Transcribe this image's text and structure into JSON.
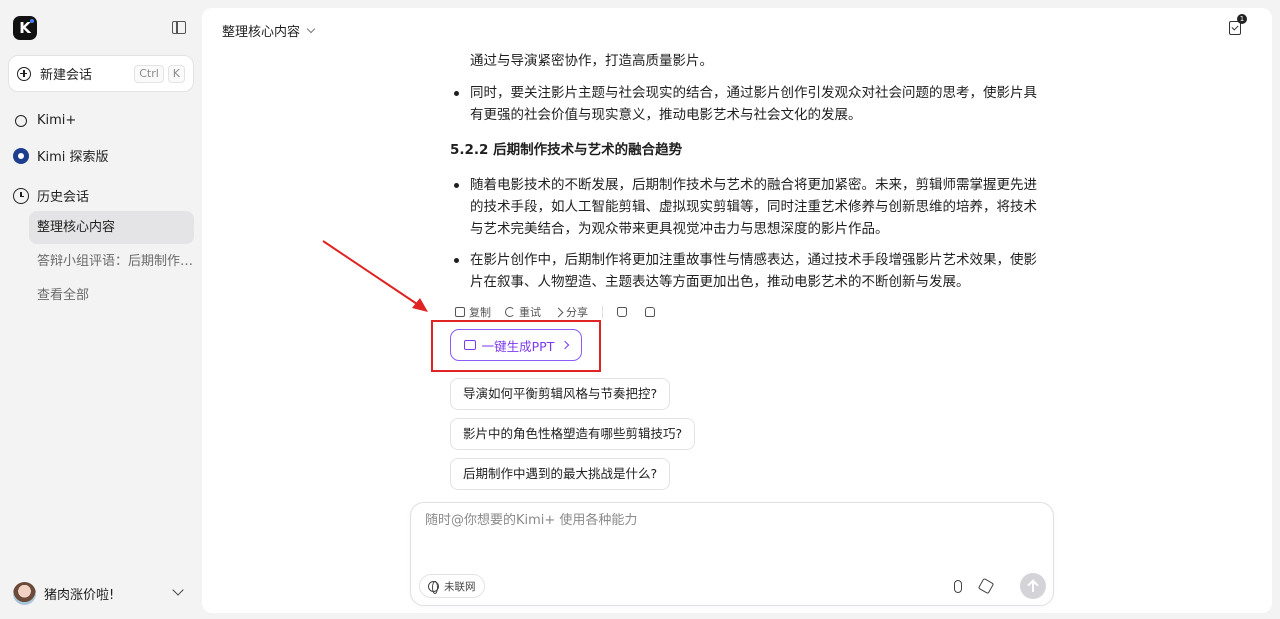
{
  "sidebar": {
    "logo": "K",
    "new_chat": {
      "label": "新建会话",
      "shortcut": [
        "Ctrl",
        "K"
      ]
    },
    "kimi_plus": "Kimi+",
    "explore": "Kimi 探索版",
    "history_label": "历史会话",
    "history": [
      {
        "title": "整理核心内容",
        "active": true
      },
      {
        "title": "答辩小组评语：后期制作专业毕业设计"
      },
      {
        "title": "查看全部"
      }
    ],
    "user_name": "猪肉涨价啦!"
  },
  "header": {
    "title": "整理核心内容",
    "task_badge": "1"
  },
  "message": {
    "lines": [
      "通过与导演紧密协作，打造高质量影片。",
      "同时，要关注影片主题与社会现实的结合，通过影片创作引发观众对社会问题的思考，使影片具",
      "有更强的社会价值与现实意义，推动电影艺术与社会文化的发展。",
      "5.2.2 后期制作技术与艺术的融合趋势",
      "随着电影技术的不断发展，后期制作技术与艺术的融合将更加紧密。未来，剪辑师需掌握更先进",
      "的技术手段，如人工智能剪辑、虚拟现实剪辑等，同时注重艺术修养与创新思维的培养，将技术",
      "与艺术完美结合，为观众带来更具视觉冲击力与思想深度的影片作品。",
      "在影片创作中，后期制作将更加注重故事性与情感表达，通过技术手段增强影片艺术效果，使影",
      "片在叙事、人物塑造、主题表达等方面更加出色，推动电影艺术的不断创新与发展。"
    ]
  },
  "actions": {
    "copy": "复制",
    "retry": "重试",
    "share": "分享"
  },
  "ppt_button": "一键生成PPT",
  "suggestions": [
    "导演如何平衡剪辑风格与节奏把控?",
    "影片中的角色性格塑造有哪些剪辑技巧?",
    "后期制作中遇到的最大挑战是什么?"
  ],
  "input": {
    "placeholder": "随时@你想要的Kimi+ 使用各种能力",
    "network_toggle": "未联网"
  },
  "colors": {
    "accent": "#7c3aed",
    "highlight": "#e02424"
  }
}
